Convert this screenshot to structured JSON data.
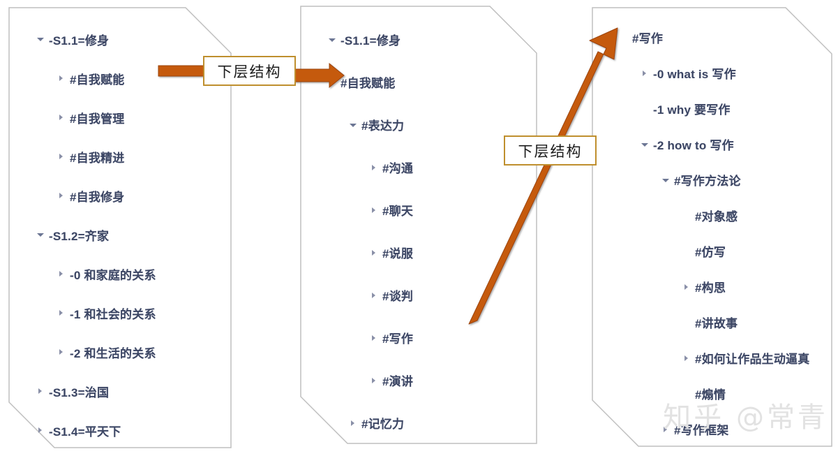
{
  "panels": [
    {
      "id": "panel-1",
      "rows": [
        {
          "marker": "down",
          "indent": 0,
          "text": "-S1.1=修身"
        },
        {
          "marker": "right",
          "indent": 1,
          "text": "#自我赋能"
        },
        {
          "marker": "right",
          "indent": 1,
          "text": "#自我管理"
        },
        {
          "marker": "right",
          "indent": 1,
          "text": "#自我精进"
        },
        {
          "marker": "right",
          "indent": 1,
          "text": "#自我修身"
        },
        {
          "marker": "down",
          "indent": 0,
          "text": "-S1.2=齐家"
        },
        {
          "marker": "right",
          "indent": 1,
          "text": "-0 和家庭的关系"
        },
        {
          "marker": "right",
          "indent": 1,
          "text": "-1 和社会的关系"
        },
        {
          "marker": "right",
          "indent": 1,
          "text": "-2 和生活的关系"
        },
        {
          "marker": "right",
          "indent": 0,
          "text": "-S1.3=治国"
        },
        {
          "marker": "right",
          "indent": 0,
          "text": "-S1.4=平天下"
        }
      ]
    },
    {
      "id": "panel-2",
      "rows": [
        {
          "marker": "down",
          "indent": 0,
          "text": "-S1.1=修身"
        },
        {
          "marker": "down",
          "indent": 0,
          "text": "#自我赋能"
        },
        {
          "marker": "down",
          "indent": 1,
          "text": "#表达力"
        },
        {
          "marker": "right",
          "indent": 2,
          "text": "#沟通"
        },
        {
          "marker": "right",
          "indent": 2,
          "text": "#聊天"
        },
        {
          "marker": "right",
          "indent": 2,
          "text": "#说服"
        },
        {
          "marker": "right",
          "indent": 2,
          "text": "#谈判"
        },
        {
          "marker": "right",
          "indent": 2,
          "text": "#写作"
        },
        {
          "marker": "right",
          "indent": 2,
          "text": "#演讲"
        },
        {
          "marker": "right",
          "indent": 1,
          "text": "#记忆力"
        }
      ]
    },
    {
      "id": "panel-3",
      "rows": [
        {
          "marker": "none",
          "indent": 0,
          "text": "#写作"
        },
        {
          "marker": "right",
          "indent": 1,
          "text": "-0 what is 写作"
        },
        {
          "marker": "none",
          "indent": 1,
          "text": "-1 why 要写作"
        },
        {
          "marker": "down",
          "indent": 1,
          "text": "-2 how to 写作"
        },
        {
          "marker": "down",
          "indent": 2,
          "text": "#写作方法论"
        },
        {
          "marker": "none",
          "indent": 3,
          "text": "#对象感"
        },
        {
          "marker": "none",
          "indent": 3,
          "text": "#仿写"
        },
        {
          "marker": "right",
          "indent": 3,
          "text": "#构思"
        },
        {
          "marker": "none",
          "indent": 3,
          "text": "#讲故事"
        },
        {
          "marker": "right",
          "indent": 3,
          "text": "#如何让作品生动逼真"
        },
        {
          "marker": "none",
          "indent": 3,
          "text": "#煽情"
        },
        {
          "marker": "right",
          "indent": 2,
          "text": "#写作框架"
        }
      ]
    }
  ],
  "callouts": [
    {
      "id": "callout-1",
      "text": "下层结构"
    },
    {
      "id": "callout-2",
      "text": "下层结构"
    }
  ],
  "watermark": {
    "text": "知乎 @常青"
  },
  "colors": {
    "arrow": "#C55A11",
    "arrow_dark": "#9C4510",
    "callout_border": "#BF8F2E",
    "text": "#3C4664",
    "marker": "#6C7694",
    "panel_border": "#BFBFBF",
    "watermark": "#E2E2E2"
  }
}
